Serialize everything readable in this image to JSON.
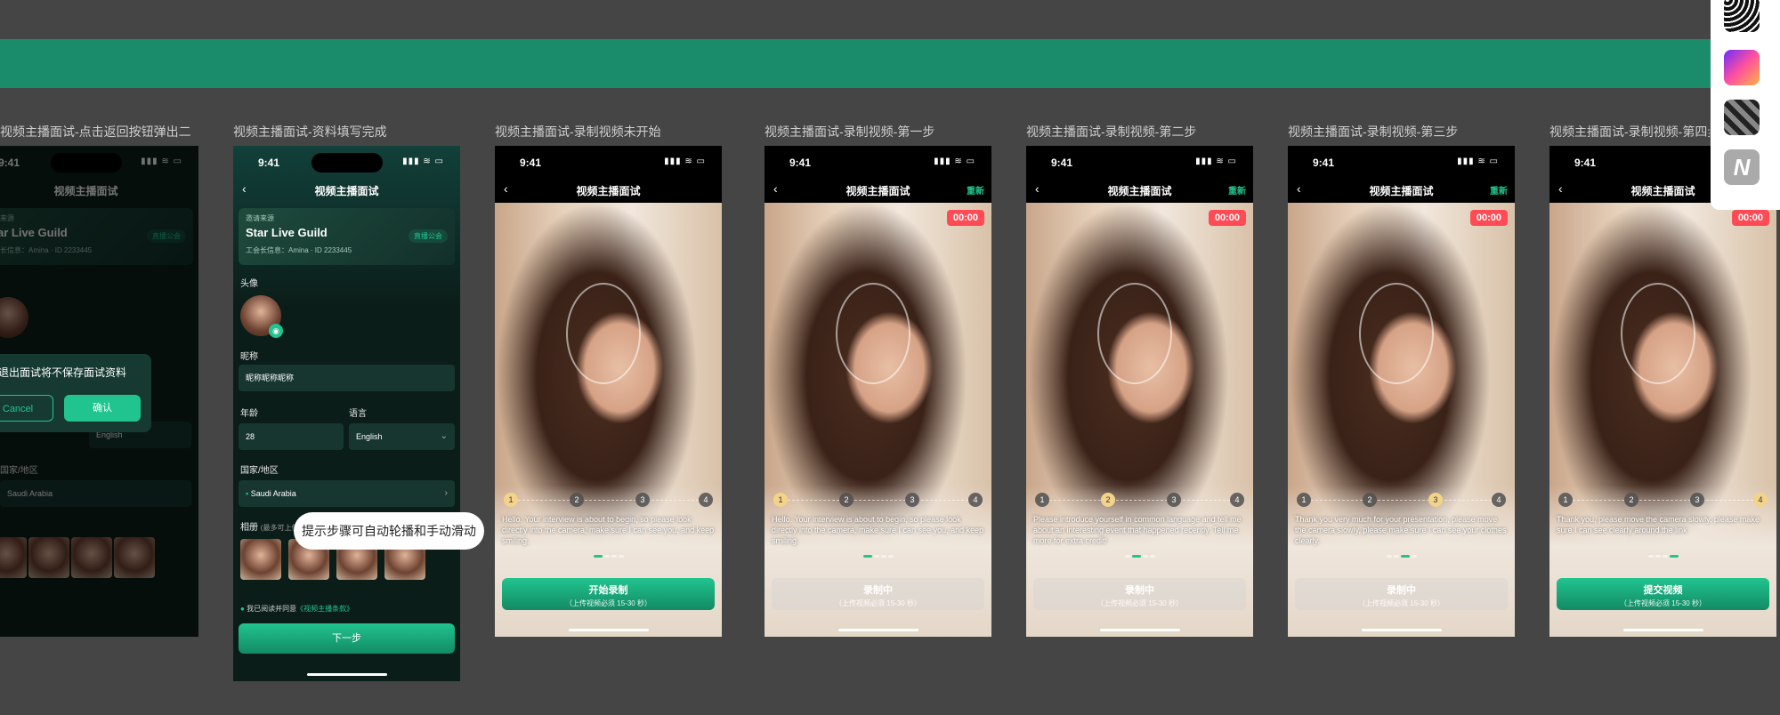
{
  "frames": [
    {
      "title": "视频主播面试-点击返回按钮弹出二次...",
      "type": "dialog"
    },
    {
      "title": "视频主播面试-资料填写完成",
      "type": "form"
    },
    {
      "title": "视频主播面试-录制视频未开始",
      "type": "record",
      "active": 1,
      "caption": "Hello. Your interview is about to begin, so please look directly into the camera, make sure I can see you, and keep smiling.",
      "btn": "开始录制",
      "btn_green": true,
      "timer": false,
      "redo": false
    },
    {
      "title": "视频主播面试-录制视频-第一步",
      "type": "record",
      "active": 1,
      "caption": "Hello. Your interview is about to begin, so please look directly into the camera, make sure I can see you, and keep smiling.",
      "btn": "录制中",
      "btn_green": false,
      "timer": true,
      "redo": true
    },
    {
      "title": "视频主播面试-录制视频-第二步",
      "type": "record",
      "active": 2,
      "caption": "Please introduce yourself in common language and tell me about an interesting event that happened recently. Tell me more for extra credit!",
      "btn": "录制中",
      "btn_green": false,
      "timer": true,
      "redo": true
    },
    {
      "title": "视频主播面试-录制视频-第三步",
      "type": "record",
      "active": 3,
      "caption": "Thank you very much for your presentation, please move the camera slowly, please make sure I can see your clothes clearly.",
      "btn": "录制中",
      "btn_green": false,
      "timer": true,
      "redo": true
    },
    {
      "title": "视频主播面试-录制视频-第四步",
      "type": "record",
      "active": 4,
      "caption": "Thank you, please move the camera slowly, please make sure I can see clearly around the link",
      "btn": "提交视频",
      "btn_green": true,
      "timer": true,
      "redo": true
    }
  ],
  "common": {
    "time": "9:41",
    "status_icons": "▮▮▮ ≋ ▭",
    "nav_title": "视频主播面试",
    "back": "‹",
    "redo": "重新",
    "timer": "00:00",
    "btn_sub": "（上传视频必须 15-30 秒）",
    "steps": [
      "1",
      "2",
      "3",
      "4"
    ]
  },
  "form": {
    "source_label": "邀请来源",
    "guild_name": "Star Live Guild",
    "guild_sub": "工会长信息：Amina · ID 2233445",
    "guild_tag": "直播公会",
    "avatar_label": "头像",
    "nickname_label": "昵称",
    "nickname_value": "昵称昵称昵称",
    "age_label": "年龄",
    "age_value": "28",
    "lang_label": "语言",
    "lang_value": "English",
    "country_label": "国家/地区",
    "country_value": "Saudi Arabia",
    "album_label": "相册",
    "album_hint": "(最多可上传8张)",
    "agree_text": "我已阅读并同意",
    "agree_link": "《视频主播条款》",
    "next": "下一步"
  },
  "dialog": {
    "message": "退出面试将不保存面试资料",
    "cancel": "Cancel",
    "confirm": "确认"
  },
  "tooltip": "提示步骤可自动轮播和手动滑动",
  "colors": {
    "accent": "#21c48f",
    "band": "#1b8c6b",
    "timer": "#ff4b55",
    "bg": "#454545"
  }
}
